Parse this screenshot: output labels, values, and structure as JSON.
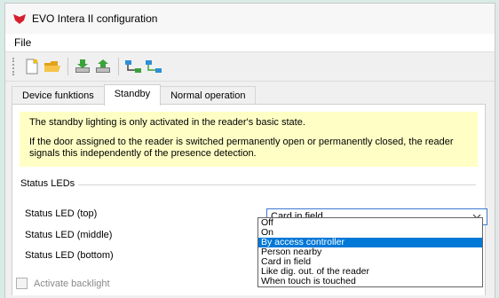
{
  "window": {
    "title": "EVO Intera II configuration"
  },
  "menu": {
    "file": "File"
  },
  "toolbar": {
    "buttons": [
      {
        "name": "new-file-icon"
      },
      {
        "name": "open-folder-icon"
      },
      {
        "name": "download-icon"
      },
      {
        "name": "upload-icon"
      },
      {
        "name": "network-connect-icon"
      },
      {
        "name": "network-transfer-icon"
      }
    ]
  },
  "tabs": [
    {
      "label": "Device funktions"
    },
    {
      "label": "Standby"
    },
    {
      "label": "Normal operation"
    }
  ],
  "info": {
    "line1": "The standby lighting is only activated in the reader's basic state.",
    "line2": "If the door assigned to the reader is switched permanently open or permanently closed, the reader signals this independently of the presence detection."
  },
  "status_leds": {
    "group_title": "Status LEDs",
    "top_label": "Status LED (top)",
    "middle_label": "Status LED (middle)",
    "bottom_label": "Status LED (bottom)",
    "top_value": "Card in field"
  },
  "dropdown": {
    "options": [
      "Off",
      "On",
      "By access controller",
      "Person nearby",
      "Card in field",
      "Like dig. out. of the reader",
      "When touch is touched"
    ],
    "highlighted_index": 2
  },
  "backlight": {
    "label": "Activate backlight",
    "checked": false
  },
  "colors": {
    "accent": "#0078d7",
    "info_bg": "#ffffc5",
    "background": "#d9ebe6"
  }
}
